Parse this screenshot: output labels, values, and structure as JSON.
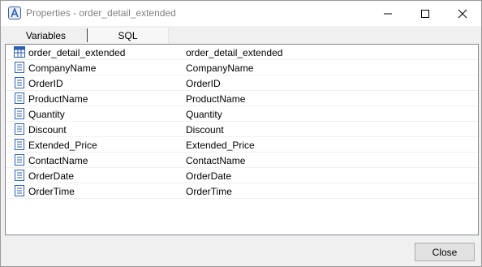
{
  "window": {
    "title": "Properties - order_detail_extended"
  },
  "tabs": [
    {
      "label": "Variables",
      "active": true
    },
    {
      "label": "SQL",
      "active": false
    }
  ],
  "rows": [
    {
      "name": "order_detail_extended",
      "value": "order_detail_extended",
      "icon": "table-icon"
    },
    {
      "name": "CompanyName",
      "value": "CompanyName",
      "icon": "field-icon"
    },
    {
      "name": "OrderID",
      "value": "OrderID",
      "icon": "field-icon"
    },
    {
      "name": "ProductName",
      "value": "ProductName",
      "icon": "field-icon"
    },
    {
      "name": "Quantity",
      "value": "Quantity",
      "icon": "field-icon"
    },
    {
      "name": "Discount",
      "value": "Discount",
      "icon": "field-icon"
    },
    {
      "name": "Extended_Price",
      "value": "Extended_Price",
      "icon": "field-icon"
    },
    {
      "name": "ContactName",
      "value": "ContactName",
      "icon": "field-icon"
    },
    {
      "name": "OrderDate",
      "value": "OrderDate",
      "icon": "field-icon"
    },
    {
      "name": "OrderTime",
      "value": "OrderTime",
      "icon": "field-icon"
    }
  ],
  "footer": {
    "close_label": "Close"
  },
  "colors": {
    "icon_blue": "#2b5fb4",
    "title_gray": "#808080"
  }
}
